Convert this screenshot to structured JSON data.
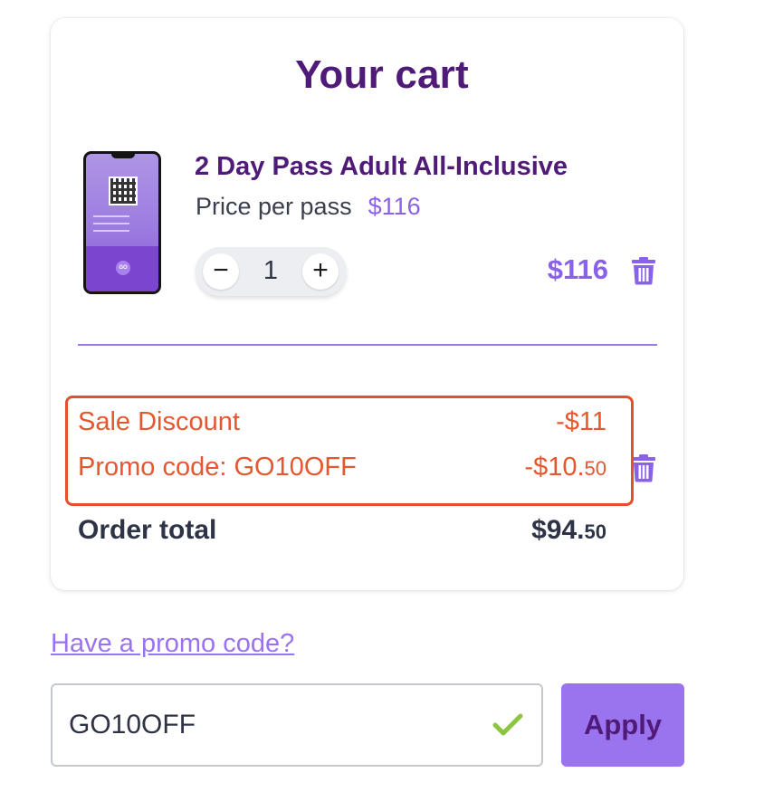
{
  "cart": {
    "title": "Your cart",
    "item": {
      "name": "2 Day Pass Adult All-Inclusive",
      "price_label": "Price per pass",
      "price_value": "$116",
      "quantity": "1",
      "minus_glyph": "−",
      "plus_glyph": "+",
      "line_total": "$116"
    },
    "discounts": {
      "sale_label": "Sale Discount",
      "sale_value": "-$11",
      "promo_label": "Promo code:  GO10OFF",
      "promo_value_main": "-$10.",
      "promo_value_cents": "50"
    },
    "order_total": {
      "label": "Order total",
      "value_main": "$94.",
      "value_cents": "50"
    }
  },
  "promo": {
    "link_text": "Have a promo code?",
    "input_value": "GO10OFF",
    "apply_label": "Apply"
  },
  "colors": {
    "brand_dark": "#4f1a78",
    "accent": "#8a62ea",
    "discount": "#e5572f",
    "success": "#8cc63f"
  },
  "icons": [
    "phone-pass-image",
    "trash-icon",
    "check-icon"
  ]
}
